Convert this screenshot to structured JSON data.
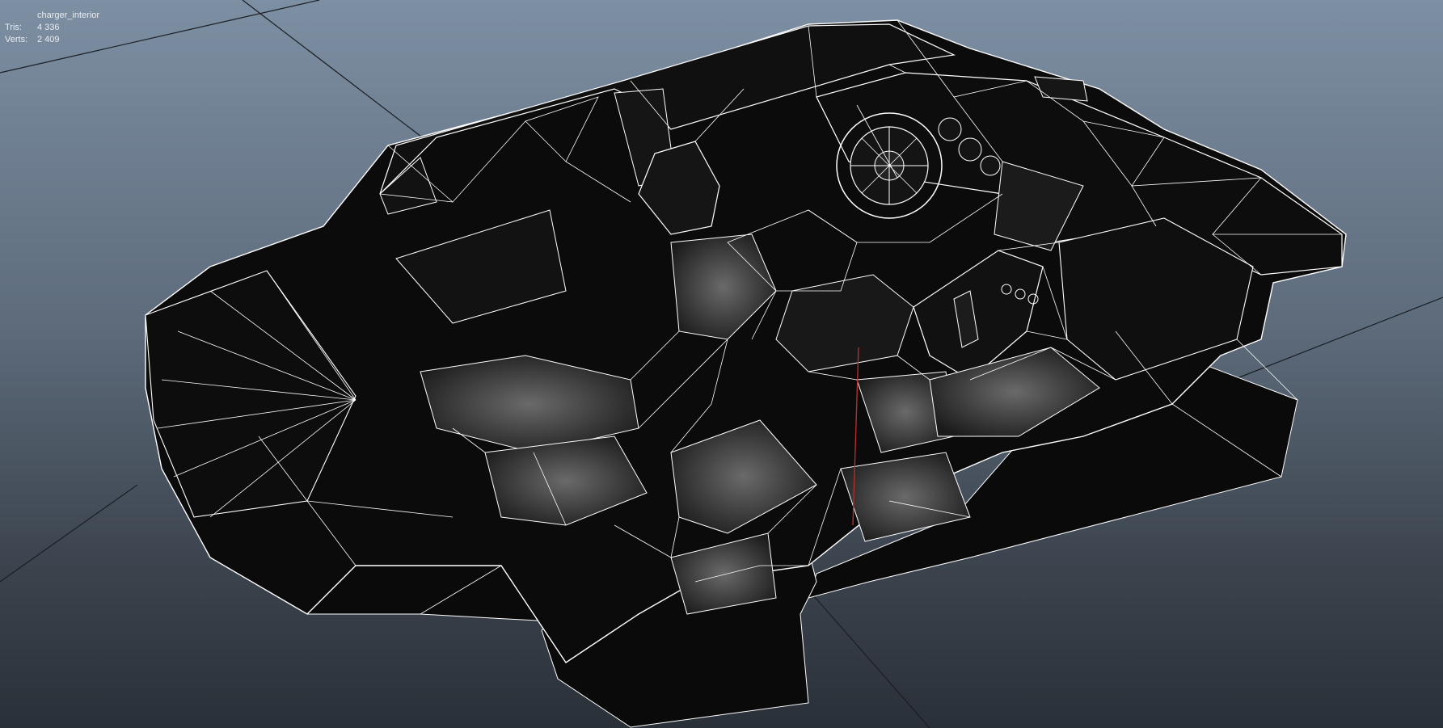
{
  "viewport": {
    "background_top": "#7d8fa3",
    "background_bottom": "#2a3038",
    "wire_color": "#ffffff",
    "mesh_fill": "#0b0b0b",
    "seat_fill": "#3a3a3a",
    "grid_color": "#1a1e24",
    "pivot_color": "#b0302c"
  },
  "hud": {
    "object_name": "charger_interior",
    "tris_label": "Tris:",
    "tris_value": "4 336",
    "verts_label": "Verts:",
    "verts_value": "2 409"
  }
}
